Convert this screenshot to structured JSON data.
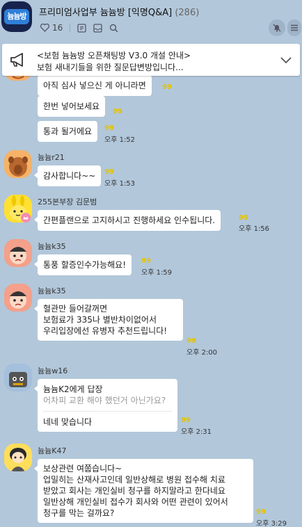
{
  "header": {
    "logo_text": "늄늄방",
    "title": "프리미엄사업부 늄늄방 [익명Q&A]",
    "member_count": "(286)",
    "like_count": "16"
  },
  "notice": {
    "line1": "<보험 늄늄방 오픈채팅방 V3.0 개설 안내>",
    "line2": "보험 새내기들을 위한 질문답변방입니다..."
  },
  "messages": [
    {
      "text": "아직 심사 넣으신 게 아니라면",
      "unread": "99"
    },
    {
      "text": "한번 넣어보세요",
      "unread": "99"
    },
    {
      "text": "통과 될거에요",
      "unread": "99",
      "time": "오후 1:52"
    },
    {
      "name": "늄늄r21",
      "text": "감사합니다~~",
      "unread": "99",
      "time": "오후 1:53"
    },
    {
      "name": "255본부장 김문범",
      "text": "간편플랜으로 고지하시고 진행하세요 인수됩니다.",
      "unread": "99",
      "time": "오후 1:56"
    },
    {
      "name": "늄늄k35",
      "text": "통풍 할증인수가능해요!",
      "unread": "99",
      "time": "오후 1:59"
    },
    {
      "name": "늄늄k35",
      "lines": [
        "혈관만 들어갈꺼면",
        "보험료가 335나 별반차이없어서",
        "우리입장에선 유병자 추천드립니다!"
      ],
      "unread": "99",
      "time": "오후 2:00"
    },
    {
      "name": "늄늄w16",
      "reply_to": "늄늄K2에게 답장",
      "reply_quote": "어차피 교환 해야 했던거 아닌가요?",
      "text": "네네 맞습니다",
      "unread": "99",
      "time": "오후 2:31"
    },
    {
      "name": "늄늄K47",
      "lines": [
        "보상관련 여쭙습니다~",
        "업밀히는 산재사고인데 일반상해로 병원 접수해 치료",
        "받았고 회사는 개인실비 청구를 하지말라고 한다네요",
        "일반상해 개인실비 접수가 회사와 어떤 관련이 있어서",
        "청구를 막는 걸까요?"
      ],
      "unread": "99",
      "time": "오후 3:29"
    }
  ]
}
